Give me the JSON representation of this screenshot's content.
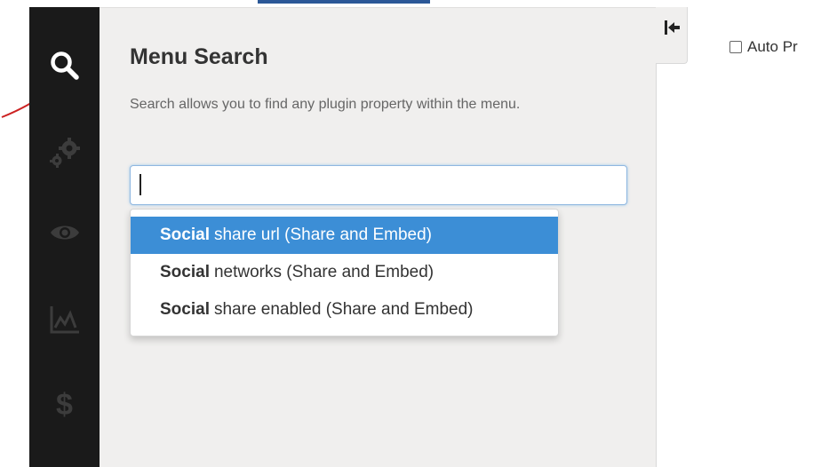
{
  "sidebar": {
    "icons": [
      {
        "name": "search-icon",
        "active": true
      },
      {
        "name": "gears-icon",
        "active": false
      },
      {
        "name": "eye-icon",
        "active": false
      },
      {
        "name": "chart-icon",
        "active": false
      },
      {
        "name": "dollar-icon",
        "glyph": "$",
        "active": false
      }
    ]
  },
  "panel": {
    "title": "Menu Search",
    "description": "Search allows you to find any plugin property within the menu.",
    "search": {
      "value": "",
      "placeholder": ""
    }
  },
  "suggestions": [
    {
      "highlight": "Social",
      "rest": "share url (Share and Embed)",
      "selected": true
    },
    {
      "highlight": "Social",
      "rest": "networks (Share and Embed)",
      "selected": false
    },
    {
      "highlight": "Social",
      "rest": "share enabled (Share and Embed)",
      "selected": false
    }
  ],
  "collapse_button": {
    "icon": "collapse-left-icon"
  },
  "main": {
    "auto_option": {
      "label": "Auto Pr",
      "checked": false
    }
  },
  "colors": {
    "rail": "#1a1a1a",
    "panel": "#f0efee",
    "accent": "#3c8ed6",
    "annotation": "#cc2222"
  }
}
